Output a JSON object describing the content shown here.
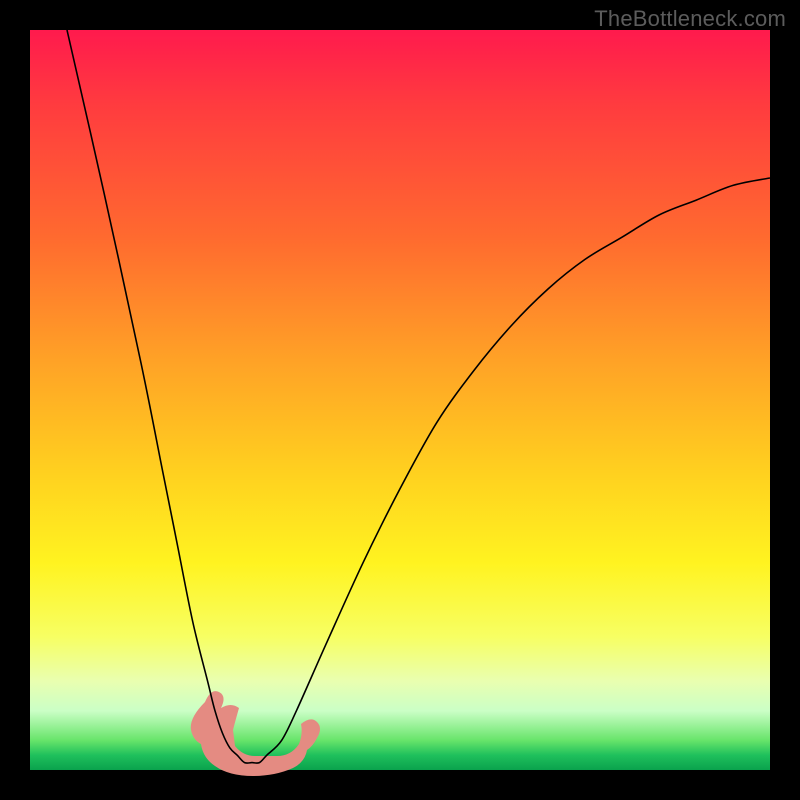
{
  "attribution": "TheBottleneck.com",
  "chart_data": {
    "type": "line",
    "title": "",
    "xlabel": "",
    "ylabel": "",
    "xlim": [
      0,
      100
    ],
    "ylim": [
      0,
      100
    ],
    "grid": false,
    "legend": false,
    "series": [
      {
        "name": "bottleneck-curve",
        "x": [
          5,
          10,
          15,
          18,
          20,
          22,
          24,
          25,
          26,
          27,
          28,
          29,
          30,
          31,
          32,
          34,
          36,
          40,
          45,
          50,
          55,
          60,
          65,
          70,
          75,
          80,
          85,
          90,
          95,
          100
        ],
        "y": [
          100,
          78,
          55,
          40,
          30,
          20,
          12,
          8,
          5,
          3,
          2,
          1,
          1,
          1,
          2,
          4,
          8,
          17,
          28,
          38,
          47,
          54,
          60,
          65,
          69,
          72,
          75,
          77,
          79,
          80
        ]
      }
    ],
    "annotations": [
      {
        "name": "blob",
        "shape": "irregular",
        "x_range": [
          23,
          33
        ],
        "y_range": [
          0,
          9
        ],
        "color": "#e48b82"
      }
    ],
    "background_gradient": {
      "direction": "top-to-bottom",
      "stops": [
        {
          "pos": 0.0,
          "color": "#ff1a4d"
        },
        {
          "pos": 0.45,
          "color": "#ffa326"
        },
        {
          "pos": 0.72,
          "color": "#fff320"
        },
        {
          "pos": 0.96,
          "color": "#67e46a"
        },
        {
          "pos": 1.0,
          "color": "#0aa24d"
        }
      ]
    }
  }
}
